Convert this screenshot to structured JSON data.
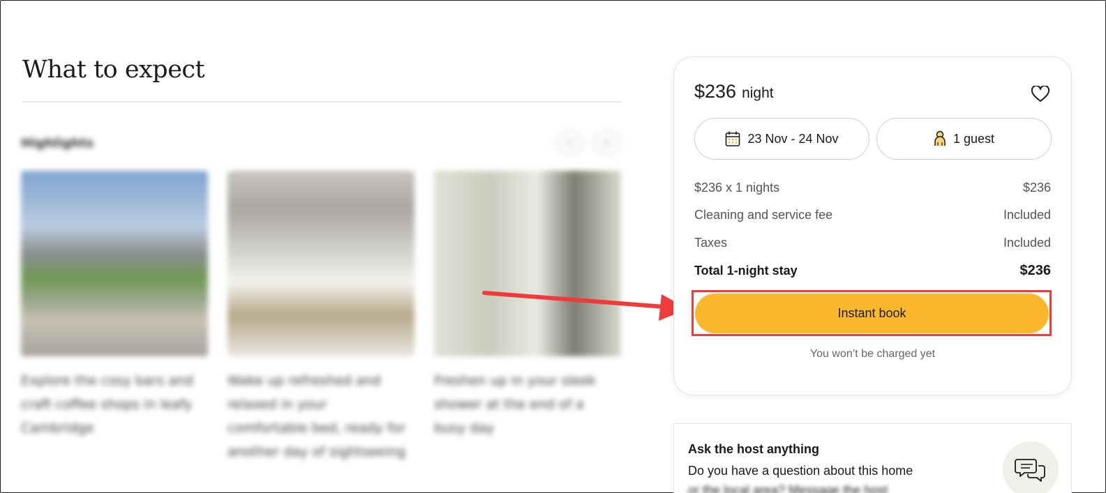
{
  "section": {
    "title": "What to expect",
    "highlights_label": "Highlights",
    "prev_icon": "‹",
    "next_icon": "›"
  },
  "cards": [
    {
      "text": "Explore the cosy bars and craft coffee shops in leafy Cambridge",
      "image": "outdoor-garden"
    },
    {
      "text": "Wake up refreshed and relaxed in your comfortable bed, ready for another day of sightseeing",
      "image": "bedroom"
    },
    {
      "text": "Freshen up in your sleek shower at the end of a busy day",
      "image": "bathroom"
    }
  ],
  "booking": {
    "price": "$236",
    "price_unit": "night",
    "dates": "23 Nov - 24 Nov",
    "guests": "1 guest",
    "line_items": [
      {
        "label": "$236 x 1 nights",
        "value": "$236"
      },
      {
        "label": "Cleaning and service fee",
        "value": "Included"
      },
      {
        "label": "Taxes",
        "value": "Included"
      }
    ],
    "total_label": "Total 1-night stay",
    "total_value": "$236",
    "book_button": "Instant book",
    "no_charge_note": "You won’t be charged yet"
  },
  "host": {
    "title": "Ask the host anything",
    "text": "Do you have a question about this home",
    "text_more": "or the local area? Message the host"
  },
  "colors": {
    "accent": "#fbb82c",
    "annotation": "#ef3b3b"
  }
}
